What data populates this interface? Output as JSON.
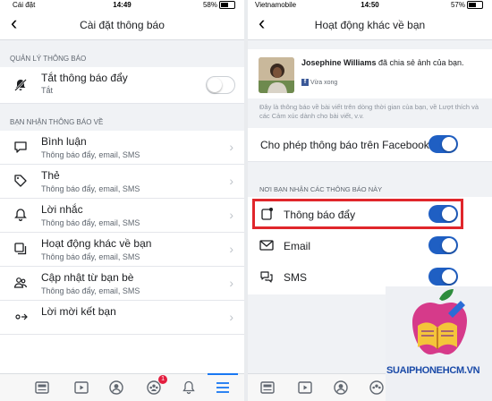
{
  "left": {
    "status": {
      "carrier": "Cái đặt",
      "time": "14:49",
      "battery": "58%"
    },
    "nav_title": "Cài đặt thông báo",
    "section1_header": "QUẢN LÝ THÔNG BÁO",
    "push": {
      "title": "Tắt thông báo đẩy",
      "sub": "Tắt",
      "on": false
    },
    "section2_header": "BẠN NHẬN THÔNG BÁO VỀ",
    "items": [
      {
        "label": "Bình luận",
        "sub": "Thông báo đẩy, email, SMS",
        "icon": "comment-icon"
      },
      {
        "label": "Thẻ",
        "sub": "Thông báo đẩy, email, SMS",
        "icon": "tag-icon"
      },
      {
        "label": "Lời nhắc",
        "sub": "Thông báo đẩy, email, SMS",
        "icon": "bell-icon"
      },
      {
        "label": "Hoạt động khác về bạn",
        "sub": "Thông báo đẩy, email, SMS",
        "icon": "copy-icon"
      },
      {
        "label": "Cập nhật từ bạn bè",
        "sub": "Thông báo đẩy, email, SMS",
        "icon": "friends-icon"
      },
      {
        "label": "Lời mời kết bạn",
        "sub": "",
        "icon": "add-friend-icon"
      }
    ],
    "tabs": {
      "friends_badge": "1"
    }
  },
  "right": {
    "status": {
      "carrier": "Vietnamobile",
      "time": "14:50",
      "battery": "57%"
    },
    "nav_title": "Hoạt động khác về bạn",
    "notification": {
      "name": "Josephine Williams",
      "text": " đã chia sẻ ảnh của bạn.",
      "time": "Vừa xong"
    },
    "description": "Đây là thông báo về bài viết trên dòng thời gian của bạn, về Lượt thích và các Cảm xúc dành cho bài viết, v.v.",
    "allow_label": "Cho phép thông báo trên Facebook",
    "section_header": "NƠI BẠN NHẬN CÁC THÔNG BÁO NÀY",
    "channels": [
      {
        "label": "Thông báo đẩy",
        "on": true
      },
      {
        "label": "Email",
        "on": true
      },
      {
        "label": "SMS",
        "on": true
      }
    ]
  },
  "watermark": "SUAIPHONEHCM.VN",
  "colors": {
    "toggle_on": "#1f5fc3",
    "highlight": "#e0262b",
    "nav_active": "#1877f2"
  }
}
